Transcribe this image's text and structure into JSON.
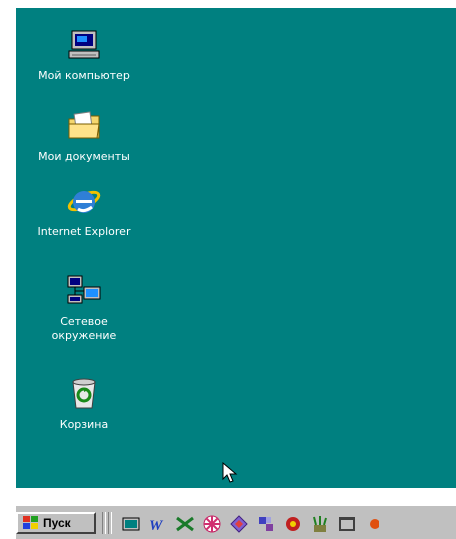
{
  "desktop": {
    "background_color": "#008080",
    "icons": [
      {
        "label": "Мой компьютер",
        "icon": "my-computer-icon"
      },
      {
        "label": "Мои документы",
        "icon": "my-documents-folder-icon"
      },
      {
        "label": "Internet Explorer",
        "icon": "internet-explorer-icon"
      },
      {
        "label": "Сетевое\nокружение",
        "icon": "network-neighborhood-icon"
      },
      {
        "label": "Корзина",
        "icon": "recycle-bin-icon"
      }
    ]
  },
  "taskbar": {
    "start_label": "Пуск",
    "quick_launch": [
      "show-desktop-icon",
      "word-icon",
      "excel-icon",
      "pinwheel-icon",
      "diamond-app-icon",
      "puzzle-app-icon",
      "flower-app-icon",
      "paint-tools-icon",
      "mail-window-icon",
      "extra-app-icon"
    ]
  }
}
